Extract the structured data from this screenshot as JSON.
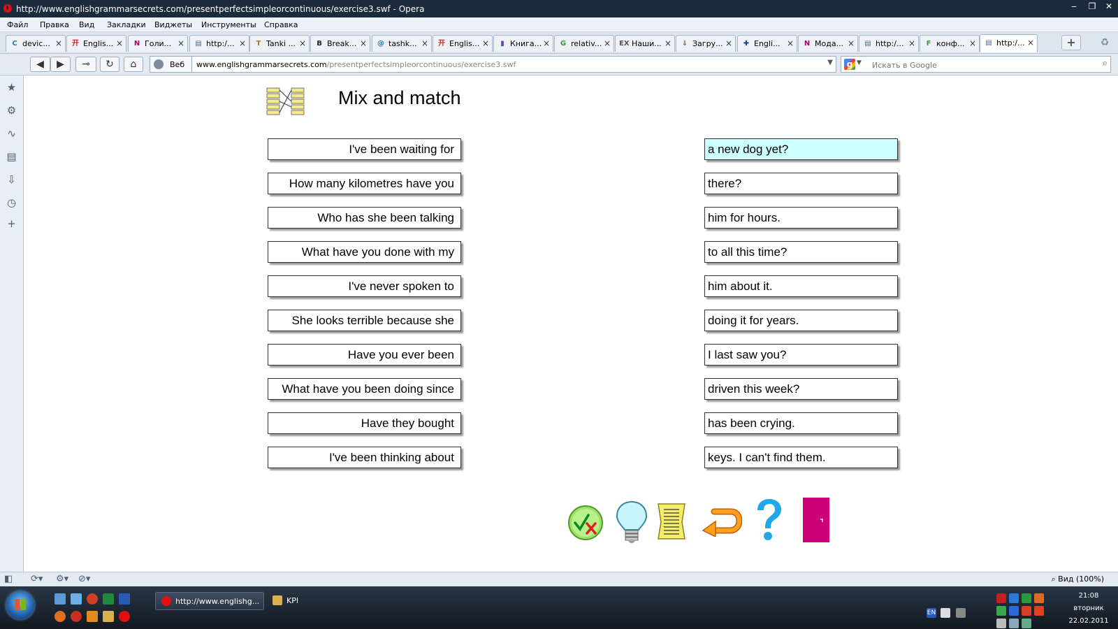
{
  "window": {
    "title": "http://www.englishgrammarsecrets.com/presentperfectsimpleorcontinuous/exercise3.swf - Opera",
    "minimize": "‒",
    "restore": "❐",
    "close": "✕"
  },
  "menu": [
    "Файл",
    "Правка",
    "Вид",
    "Закладки",
    "Виджеты",
    "Инструменты",
    "Справка"
  ],
  "tabs": [
    {
      "label": "devic...",
      "icon": "C",
      "color": "#1e73be"
    },
    {
      "label": "Englis...",
      "icon": "开",
      "color": "#d02020"
    },
    {
      "label": "Голи...",
      "icon": "N",
      "color": "#b00060"
    },
    {
      "label": "http:/...",
      "icon": "▤",
      "color": "#4a6a8a"
    },
    {
      "label": "Tanki ...",
      "icon": "T",
      "color": "#b07010"
    },
    {
      "label": "Break...",
      "icon": "B",
      "color": "#222222"
    },
    {
      "label": "tashk...",
      "icon": "@",
      "color": "#1b6ec2"
    },
    {
      "label": "Englis...",
      "icon": "开",
      "color": "#d02020"
    },
    {
      "label": "Книга...",
      "icon": "▮",
      "color": "#6a3fb0"
    },
    {
      "label": "relativ...",
      "icon": "G",
      "color": "#2a9a3a"
    },
    {
      "label": "Наши...",
      "icon": "EX",
      "color": "#555555"
    },
    {
      "label": "Загру...",
      "icon": "⇓",
      "color": "#7a6a40"
    },
    {
      "label": "Engli...",
      "icon": "✚",
      "color": "#1a3a8a"
    },
    {
      "label": "Мода...",
      "icon": "N",
      "color": "#b00060"
    },
    {
      "label": "http:/...",
      "icon": "▤",
      "color": "#4a6a8a"
    },
    {
      "label": "конф...",
      "icon": "F",
      "color": "#3b9a3b"
    },
    {
      "label": "http:/...",
      "icon": "▤",
      "color": "#4a6a8a",
      "active": true
    }
  ],
  "tab_close": "×",
  "nav": {
    "web_label": "Веб",
    "url_host": "www.englishgrammarsecrets.com",
    "url_path": "/presentperfectsimpleorcontinuous/exercise3.swf",
    "search_placeholder": "Искать в Google"
  },
  "exercise": {
    "title": "Mix and match",
    "left": [
      "I've been waiting for",
      "How many kilometres have you",
      "Who has she been talking",
      "What have you done with my",
      "I've never spoken to",
      "She looks terrible because she",
      "Have you ever been",
      "What have you been doing since",
      "Have they bought",
      "I've been thinking about"
    ],
    "right": [
      "a new dog yet?",
      "there?",
      "him for hours.",
      "to all this time?",
      "him about it.",
      "doing it for years.",
      "I last saw you?",
      "driven this week?",
      "has been crying.",
      "keys. I can't find them."
    ],
    "selected_right_index": 0,
    "selected_color": "#ccffff"
  },
  "controls": [
    {
      "name": "check-answers-icon"
    },
    {
      "name": "hint-lightbulb-icon"
    },
    {
      "name": "notes-page-icon"
    },
    {
      "name": "reset-arrow-icon"
    },
    {
      "name": "help-question-icon"
    },
    {
      "name": "exit-door-icon"
    }
  ],
  "status": {
    "zoom": "Вид (100%)"
  },
  "taskbar": {
    "tasks": [
      {
        "label": "http://www.englishg...",
        "icon_color": "#e01010"
      },
      {
        "label": "KPI",
        "icon_color": "#d8b050"
      }
    ],
    "lang": "EN",
    "time": "21:08",
    "weekday": "вторник",
    "date": "22.02.2011"
  }
}
